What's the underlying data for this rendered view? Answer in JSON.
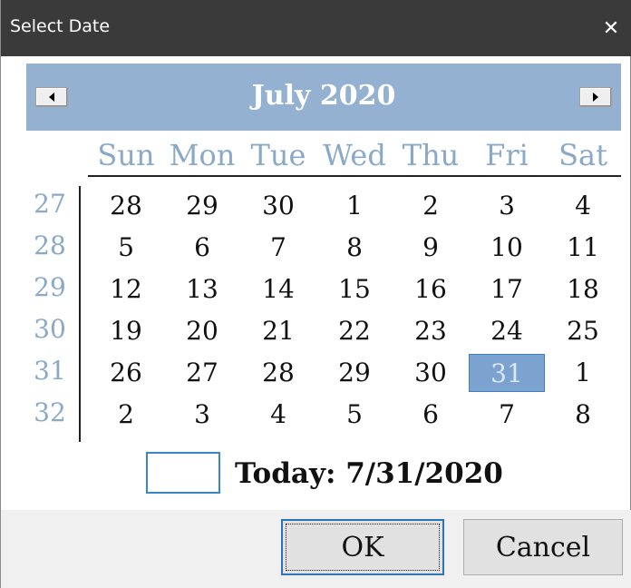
{
  "window": {
    "title": "Select Date",
    "close_glyph": "✕"
  },
  "calendar": {
    "month_title": "July 2020",
    "weekdays": [
      "Sun",
      "Mon",
      "Tue",
      "Wed",
      "Thu",
      "Fri",
      "Sat"
    ],
    "weeks": [
      {
        "number": "27",
        "days": [
          "28",
          "29",
          "30",
          "1",
          "2",
          "3",
          "4"
        ]
      },
      {
        "number": "28",
        "days": [
          "5",
          "6",
          "7",
          "8",
          "9",
          "10",
          "11"
        ]
      },
      {
        "number": "29",
        "days": [
          "12",
          "13",
          "14",
          "15",
          "16",
          "17",
          "18"
        ]
      },
      {
        "number": "30",
        "days": [
          "19",
          "20",
          "21",
          "22",
          "23",
          "24",
          "25"
        ]
      },
      {
        "number": "31",
        "days": [
          "26",
          "27",
          "28",
          "29",
          "30",
          "31",
          "1"
        ]
      },
      {
        "number": "32",
        "days": [
          "2",
          "3",
          "4",
          "5",
          "6",
          "7",
          "8"
        ]
      }
    ],
    "selected_day": "31",
    "today_label": "Today: 7/31/2020"
  },
  "buttons": {
    "ok": "OK",
    "cancel": "Cancel"
  },
  "colors": {
    "titlebar": "#3a3a3a",
    "header": "#94b1d1",
    "muted_label": "#8aa8c8",
    "selection": "#7ca3cf",
    "focus_border": "#2f73b8"
  }
}
